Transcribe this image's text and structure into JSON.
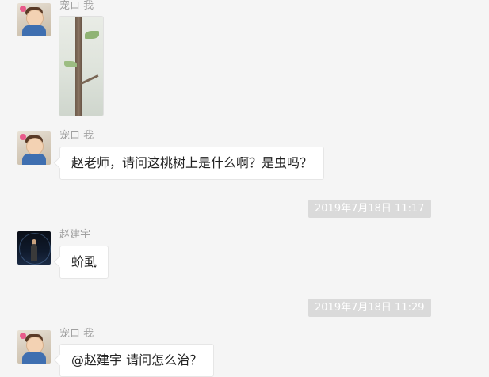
{
  "conversation": {
    "msg1": {
      "sender": "宠ロ 我"
    },
    "msg2": {
      "sender": "宠ロ 我",
      "text": "赵老师，请问这桃树上是什么啊？是虫吗？"
    },
    "time1": "2019年7月18日 11:17",
    "msg3": {
      "sender": "赵建宇",
      "text": "蚧虱"
    },
    "time2": "2019年7月18日 11:29",
    "msg4": {
      "sender": "宠ロ 我",
      "text": "@赵建宇 请问怎么治？"
    }
  }
}
